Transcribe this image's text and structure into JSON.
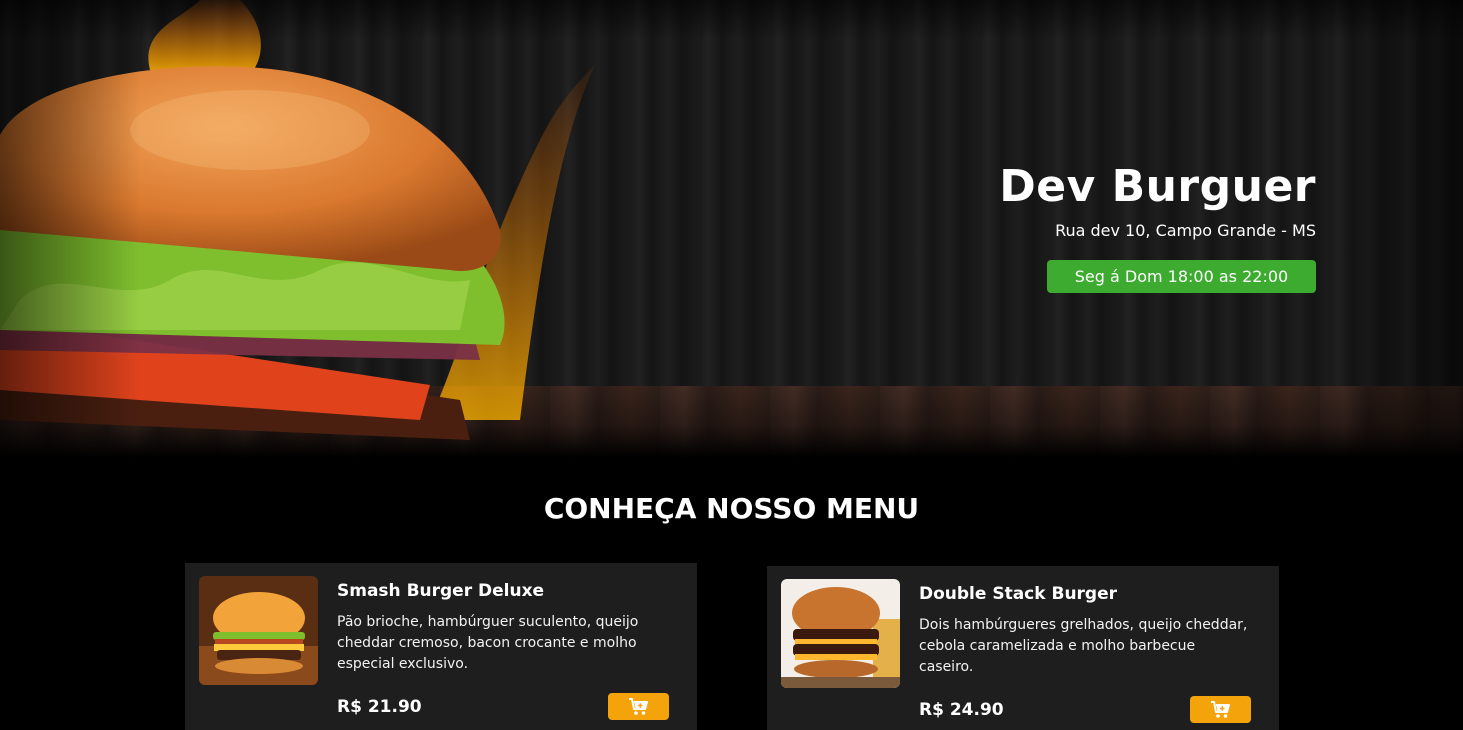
{
  "hero": {
    "title": "Dev Burguer",
    "address": "Rua dev 10, Campo Grande - MS",
    "hours": "Seg á Dom 18:00 as 22:00"
  },
  "menu": {
    "heading": "CONHEÇA NOSSO MENU",
    "items": [
      {
        "name": "Smash Burger Deluxe",
        "description": "Pão brioche, hambúrguer suculento, queijo cheddar cremoso, bacon crocante e molho especial exclusivo.",
        "price": "R$ 21.90",
        "cart_icon": "add-to-cart-icon"
      },
      {
        "name": "Double Stack Burger",
        "description": "Dois hambúrgueres grelhados, queijo cheddar, cebola caramelizada e molho barbecue caseiro.",
        "price": "R$ 24.90",
        "cart_icon": "add-to-cart-icon"
      }
    ]
  },
  "colors": {
    "hours_badge": "#3cab2f",
    "cart_button": "#f5a30a",
    "card_background": "#1e1e1e",
    "page_background": "#000000"
  }
}
